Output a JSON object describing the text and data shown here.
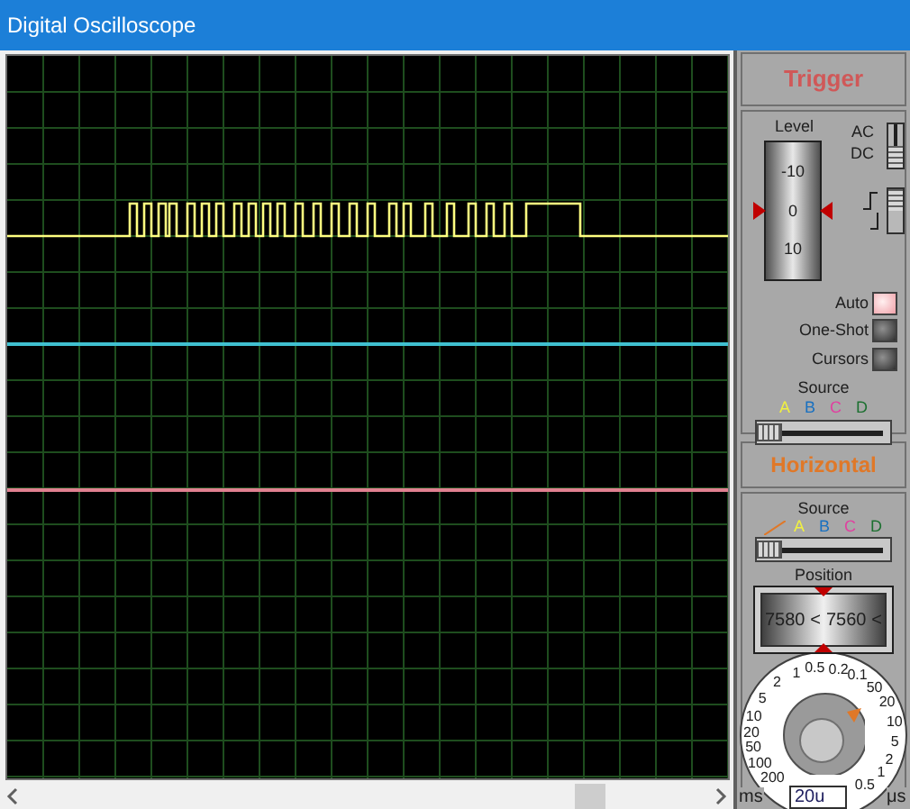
{
  "window": {
    "title": "Digital Oscilloscope"
  },
  "screen": {
    "traces": [
      {
        "color": "#ffff80",
        "kind": "pulses"
      },
      {
        "color": "#40c0d0",
        "kind": "flat"
      },
      {
        "color": "#e08090",
        "kind": "flat"
      }
    ]
  },
  "trigger": {
    "title": "Trigger",
    "level_label": "Level",
    "level_marks": [
      "-10",
      "0",
      "10"
    ],
    "coupling": [
      {
        "label": "AC",
        "selected": false
      },
      {
        "label": "DC",
        "selected": true
      }
    ],
    "slope_rising": true,
    "modes": [
      {
        "label": "Auto",
        "on": true
      },
      {
        "label": "One-Shot",
        "on": false
      },
      {
        "label": "Cursors",
        "on": false
      }
    ],
    "source_label": "Source",
    "sources": [
      {
        "label": "A",
        "color": "#f0f040"
      },
      {
        "label": "B",
        "color": "#1870c0"
      },
      {
        "label": "C",
        "color": "#e040a0"
      },
      {
        "label": "D",
        "color": "#1c7030"
      }
    ],
    "source_slider": {
      "level": 0
    }
  },
  "horizontal": {
    "title": "Horizontal",
    "source_label": "Source",
    "sources": [
      {
        "label": "A",
        "color": "#f0f040"
      },
      {
        "label": "B",
        "color": "#1870c0"
      },
      {
        "label": "C",
        "color": "#e040a0"
      },
      {
        "label": "D",
        "color": "#1c7030"
      }
    ],
    "source_slider": {
      "level": 0
    },
    "position_label": "Position",
    "position_readout": [
      "7580",
      "<",
      "7560",
      "<"
    ],
    "timebase": {
      "left_marks": [
        "0.5",
        "1",
        "2",
        "5",
        "10",
        "20",
        "50",
        "100",
        "200"
      ],
      "right_marks": [
        "0.2",
        "0.1",
        "50",
        "20",
        "10",
        "5",
        "2",
        "1",
        "0.5"
      ],
      "left_unit": "ms",
      "right_unit": "μs",
      "value": "20u"
    }
  }
}
